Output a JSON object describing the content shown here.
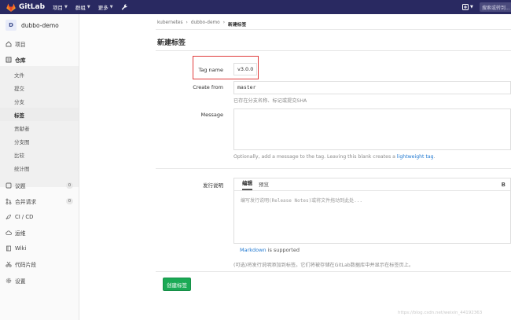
{
  "topbar": {
    "brand": "GitLab",
    "nav": [
      "项目",
      "群组",
      "更多"
    ],
    "search_placeholder": "搜索或转到..."
  },
  "sidebar": {
    "project_initial": "D",
    "project_name": "dubbo-demo",
    "items": [
      {
        "label": "项目",
        "icon": "home-icon"
      },
      {
        "label": "仓库",
        "icon": "repo-icon"
      },
      {
        "label": "议题",
        "icon": "issues-icon",
        "badge": "0"
      },
      {
        "label": "合并请求",
        "icon": "merge-request-icon",
        "badge": "0"
      },
      {
        "label": "CI / CD",
        "icon": "rocket-icon"
      },
      {
        "label": "运维",
        "icon": "cloud-icon"
      },
      {
        "label": "Wiki",
        "icon": "book-icon"
      },
      {
        "label": "代码片段",
        "icon": "scissors-icon"
      },
      {
        "label": "设置",
        "icon": "gear-icon"
      }
    ],
    "repo_sub": [
      "文件",
      "提交",
      "分支",
      "标签",
      "贡献者",
      "分支图",
      "比较",
      "统计图"
    ]
  },
  "breadcrumb": [
    "kubernetes",
    "dubbo-demo",
    "新建标签"
  ],
  "page_title": "新建标签",
  "form": {
    "tag_name_label": "Tag name",
    "tag_name_value": "v3.0.0",
    "create_from_label": "Create from",
    "create_from_value": "master",
    "create_from_help": "已存在分支名称、标记或提交SHA",
    "message_label": "Message",
    "message_help_prefix": "Optionally, add a message to the tag. Leaving this blank creates a ",
    "message_help_link": "lightweight tag",
    "message_help_suffix": ".",
    "release_label": "发行说明",
    "tab_write": "编辑",
    "tab_preview": "预览",
    "bold_button": "B",
    "release_placeholder": "编写发行说明(Release Notes)或将文件拖动到此处...",
    "markdown_link": "Markdown",
    "markdown_suffix": " is supported",
    "release_help": "(可选)将发行说明添加到标签。它们将被存储在GitLab数据库中并显示在标签页上。",
    "create_button": "创建标签"
  },
  "watermark": "https://blog.csdn.net/weixin_44192363",
  "colors": {
    "navbar": "#292961",
    "primary_green": "#1aaa55",
    "link_blue": "#1f78d1",
    "highlight_red": "#e03b3b"
  }
}
